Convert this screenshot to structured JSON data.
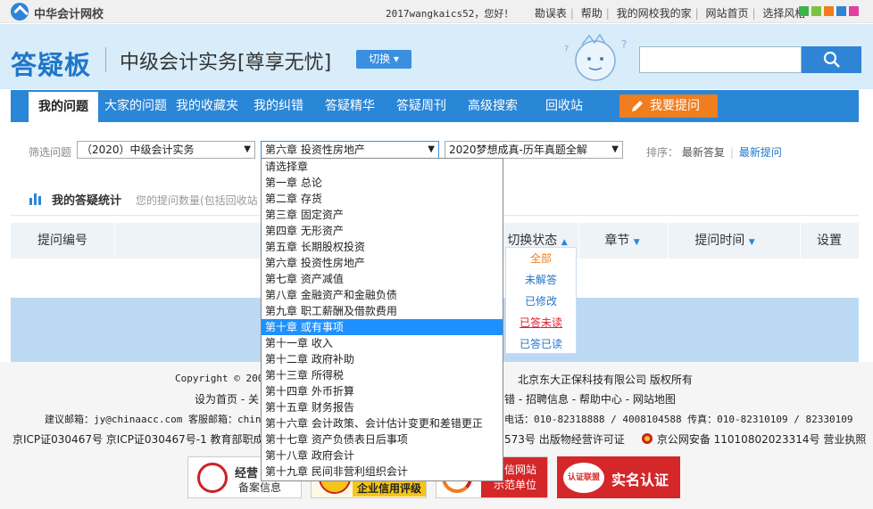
{
  "topbar": {
    "logo_text": "中华会计网校",
    "greeting": "2017wangkaics52，您好！",
    "links": [
      "勘误表",
      "帮助",
      "我的网校我的家",
      "网站首页",
      "选择风格"
    ],
    "theme_colors": [
      "#3cb44b",
      "#7cc242",
      "#f07d1e",
      "#2f84d6",
      "#e040a0"
    ]
  },
  "header": {
    "brand": "答疑板",
    "course_title": "中级会计实务[尊享无忧]",
    "switch_label": "切换",
    "search_placeholder": ""
  },
  "nav": {
    "items": [
      "我的问题",
      "大家的问题",
      "我的收藏夹",
      "我的纠错",
      "答疑精华",
      "答疑周刊",
      "高级搜索",
      "回收站"
    ],
    "ask_label": "我要提问"
  },
  "filter": {
    "label": "筛选问题",
    "course_select": "（2020）中级会计实务",
    "chapter_select": "第六章 投资性房地产",
    "book_select": "2020梦想成真-历年真题全解",
    "sort_label": "排序：",
    "sort_options": [
      "最新答复",
      "最新提问"
    ]
  },
  "chapters": [
    "请选择章",
    "第一章 总论",
    "第二章 存货",
    "第三章 固定资产",
    "第四章 无形资产",
    "第五章 长期股权投资",
    "第六章 投资性房地产",
    "第七章 资产减值",
    "第八章 金融资产和金融负债",
    "第九章 职工薪酬及借款费用",
    "第十章 或有事项",
    "第十一章 收入",
    "第十二章 政府补助",
    "第十三章 所得税",
    "第十四章 外币折算",
    "第十五章 财务报告",
    "第十六章 会计政策、会计估计变更和差错更正",
    "第十七章 资产负债表日后事项",
    "第十八章 政府会计",
    "第十九章 民间非营利组织会计"
  ],
  "highlighted_chapter": "第十章 或有事项",
  "stats": {
    "title": "我的答疑统计",
    "subtitle": "您的提问数量(包括回收站"
  },
  "table": {
    "headers": [
      "提问编号",
      "切换状态",
      "章节",
      "提问时间",
      "设置"
    ]
  },
  "status_menu": [
    "全部",
    "未解答",
    "已修改",
    "已答未读",
    "已答已读"
  ],
  "footer": {
    "copyright_left": "Copyright © 200",
    "copyright_right": "北京东大正保科技有限公司 版权所有",
    "links_left": "设为首页 - 关",
    "links_right": "错 - 招聘信息 - 帮助中心 - 网站地图",
    "contact_left": "建议邮箱：jy@chinaacc.com 客服邮箱：chin",
    "contact_right": "电话：010-82318888 / 4008104588 传真：010-82310109 / 82330109",
    "icp_left": "京ICP证030467号   京ICP证030467号-1   教育部职成",
    "icp_mid": "573号   出版物经营许可证",
    "icp_right": "京公网安备 11010802023314号   营业执照",
    "badges": [
      "经营",
      "备案信息",
      "企业信用评级",
      "可信网站",
      "示范单位",
      "认证联盟",
      "实名认证"
    ]
  }
}
